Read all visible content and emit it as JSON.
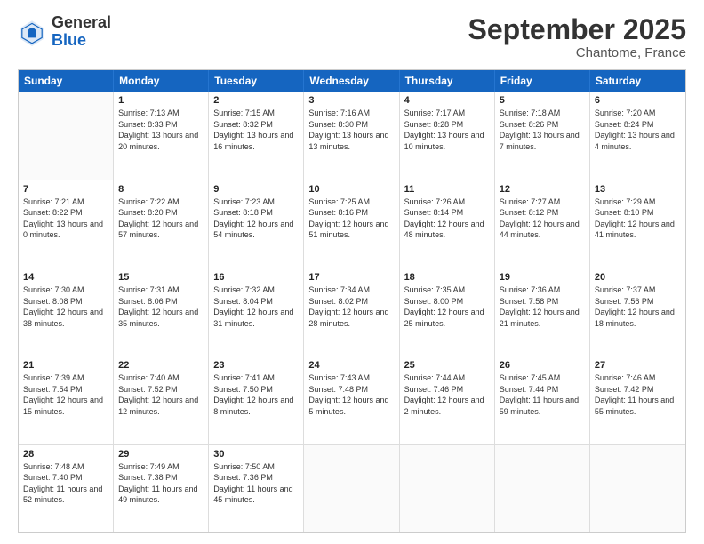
{
  "logo": {
    "text_general": "General",
    "text_blue": "Blue"
  },
  "header": {
    "title": "September 2025",
    "subtitle": "Chantome, France"
  },
  "weekdays": [
    "Sunday",
    "Monday",
    "Tuesday",
    "Wednesday",
    "Thursday",
    "Friday",
    "Saturday"
  ],
  "weeks": [
    [
      {
        "day": "",
        "empty": true
      },
      {
        "day": "1",
        "sunrise": "7:13 AM",
        "sunset": "8:33 PM",
        "daylight": "13 hours and 20 minutes."
      },
      {
        "day": "2",
        "sunrise": "7:15 AM",
        "sunset": "8:32 PM",
        "daylight": "13 hours and 16 minutes."
      },
      {
        "day": "3",
        "sunrise": "7:16 AM",
        "sunset": "8:30 PM",
        "daylight": "13 hours and 13 minutes."
      },
      {
        "day": "4",
        "sunrise": "7:17 AM",
        "sunset": "8:28 PM",
        "daylight": "13 hours and 10 minutes."
      },
      {
        "day": "5",
        "sunrise": "7:18 AM",
        "sunset": "8:26 PM",
        "daylight": "13 hours and 7 minutes."
      },
      {
        "day": "6",
        "sunrise": "7:20 AM",
        "sunset": "8:24 PM",
        "daylight": "13 hours and 4 minutes."
      }
    ],
    [
      {
        "day": "7",
        "sunrise": "7:21 AM",
        "sunset": "8:22 PM",
        "daylight": "13 hours and 0 minutes."
      },
      {
        "day": "8",
        "sunrise": "7:22 AM",
        "sunset": "8:20 PM",
        "daylight": "12 hours and 57 minutes."
      },
      {
        "day": "9",
        "sunrise": "7:23 AM",
        "sunset": "8:18 PM",
        "daylight": "12 hours and 54 minutes."
      },
      {
        "day": "10",
        "sunrise": "7:25 AM",
        "sunset": "8:16 PM",
        "daylight": "12 hours and 51 minutes."
      },
      {
        "day": "11",
        "sunrise": "7:26 AM",
        "sunset": "8:14 PM",
        "daylight": "12 hours and 48 minutes."
      },
      {
        "day": "12",
        "sunrise": "7:27 AM",
        "sunset": "8:12 PM",
        "daylight": "12 hours and 44 minutes."
      },
      {
        "day": "13",
        "sunrise": "7:29 AM",
        "sunset": "8:10 PM",
        "daylight": "12 hours and 41 minutes."
      }
    ],
    [
      {
        "day": "14",
        "sunrise": "7:30 AM",
        "sunset": "8:08 PM",
        "daylight": "12 hours and 38 minutes."
      },
      {
        "day": "15",
        "sunrise": "7:31 AM",
        "sunset": "8:06 PM",
        "daylight": "12 hours and 35 minutes."
      },
      {
        "day": "16",
        "sunrise": "7:32 AM",
        "sunset": "8:04 PM",
        "daylight": "12 hours and 31 minutes."
      },
      {
        "day": "17",
        "sunrise": "7:34 AM",
        "sunset": "8:02 PM",
        "daylight": "12 hours and 28 minutes."
      },
      {
        "day": "18",
        "sunrise": "7:35 AM",
        "sunset": "8:00 PM",
        "daylight": "12 hours and 25 minutes."
      },
      {
        "day": "19",
        "sunrise": "7:36 AM",
        "sunset": "7:58 PM",
        "daylight": "12 hours and 21 minutes."
      },
      {
        "day": "20",
        "sunrise": "7:37 AM",
        "sunset": "7:56 PM",
        "daylight": "12 hours and 18 minutes."
      }
    ],
    [
      {
        "day": "21",
        "sunrise": "7:39 AM",
        "sunset": "7:54 PM",
        "daylight": "12 hours and 15 minutes."
      },
      {
        "day": "22",
        "sunrise": "7:40 AM",
        "sunset": "7:52 PM",
        "daylight": "12 hours and 12 minutes."
      },
      {
        "day": "23",
        "sunrise": "7:41 AM",
        "sunset": "7:50 PM",
        "daylight": "12 hours and 8 minutes."
      },
      {
        "day": "24",
        "sunrise": "7:43 AM",
        "sunset": "7:48 PM",
        "daylight": "12 hours and 5 minutes."
      },
      {
        "day": "25",
        "sunrise": "7:44 AM",
        "sunset": "7:46 PM",
        "daylight": "12 hours and 2 minutes."
      },
      {
        "day": "26",
        "sunrise": "7:45 AM",
        "sunset": "7:44 PM",
        "daylight": "11 hours and 59 minutes."
      },
      {
        "day": "27",
        "sunrise": "7:46 AM",
        "sunset": "7:42 PM",
        "daylight": "11 hours and 55 minutes."
      }
    ],
    [
      {
        "day": "28",
        "sunrise": "7:48 AM",
        "sunset": "7:40 PM",
        "daylight": "11 hours and 52 minutes."
      },
      {
        "day": "29",
        "sunrise": "7:49 AM",
        "sunset": "7:38 PM",
        "daylight": "11 hours and 49 minutes."
      },
      {
        "day": "30",
        "sunrise": "7:50 AM",
        "sunset": "7:36 PM",
        "daylight": "11 hours and 45 minutes."
      },
      {
        "day": "",
        "empty": true
      },
      {
        "day": "",
        "empty": true
      },
      {
        "day": "",
        "empty": true
      },
      {
        "day": "",
        "empty": true
      }
    ]
  ]
}
